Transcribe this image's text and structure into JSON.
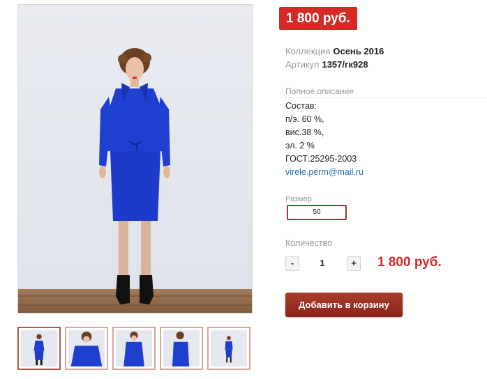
{
  "product": {
    "price_badge": "1 800 руб.",
    "collection_label": "Коллекция",
    "collection_value": "Осень 2016",
    "article_label": "Артикул",
    "article_value": "1357/гк928"
  },
  "description": {
    "heading": "Полное описание",
    "lines": [
      "Состав:",
      "п/э. 60 %,",
      "вис.38 %,",
      "эл. 2 %",
      "ГОСТ:25295-2003"
    ],
    "email": "virele.perm@mail.ru"
  },
  "size": {
    "label": "Размер",
    "selected": "50"
  },
  "quantity": {
    "label": "Количество",
    "minus": "-",
    "value": "1",
    "plus": "+",
    "total": "1 800 руб."
  },
  "add_to_cart_label": "Добавить в корзину",
  "colors": {
    "accent_red": "#d52a26",
    "button_dark_red": "#8a2518",
    "suit_blue": "#1f3fd0"
  },
  "thumbnails": [
    {
      "view": "front-full"
    },
    {
      "view": "detail-top"
    },
    {
      "view": "front-close"
    },
    {
      "view": "side"
    },
    {
      "view": "front-full-small"
    }
  ]
}
